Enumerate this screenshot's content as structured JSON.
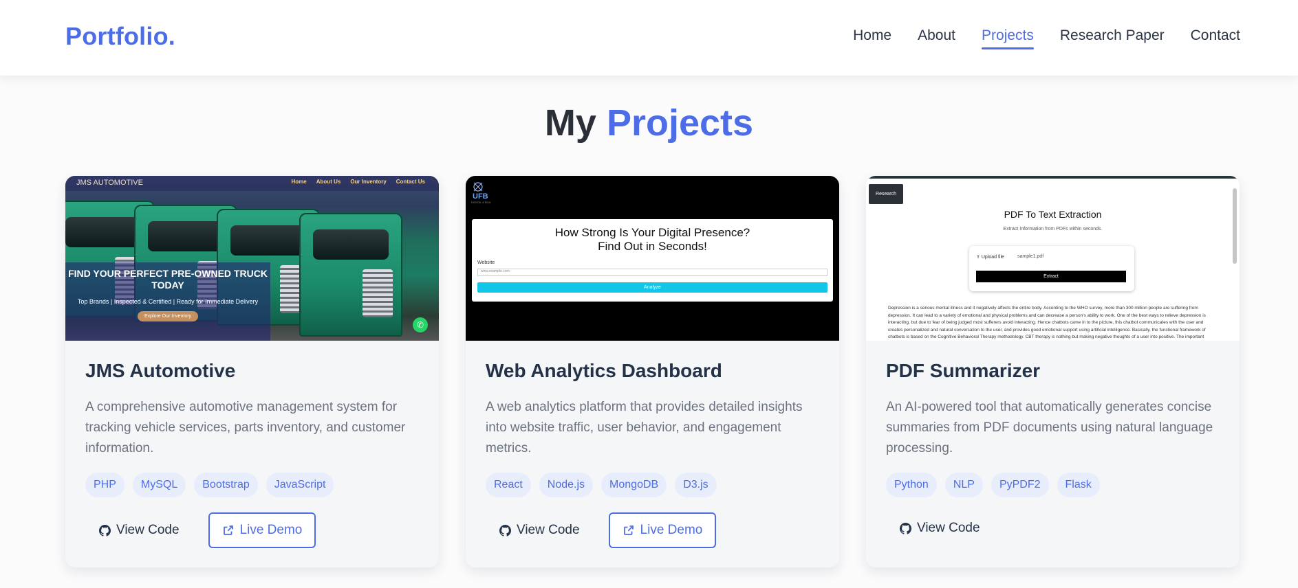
{
  "header": {
    "brand": "Portfolio.",
    "nav": [
      "Home",
      "About",
      "Projects",
      "Research Paper",
      "Contact"
    ],
    "active_nav": "Projects"
  },
  "section": {
    "title_part1": "My",
    "title_part2": "Projects"
  },
  "projects": [
    {
      "title": "JMS Automotive",
      "description": "A comprehensive automotive management system for tracking vehicle services, parts inventory, and customer information.",
      "tags": [
        "PHP",
        "MySQL",
        "Bootstrap",
        "JavaScript"
      ],
      "code_label": "View Code",
      "demo_label": "Live Demo",
      "screenshot": {
        "site_name": "JMS AUTOMOTIVE",
        "nav": [
          "Home",
          "About Us",
          "Our Inventory",
          "Contact Us"
        ],
        "headline": "FIND YOUR PERFECT PRE-OWNED TRUCK TODAY",
        "subline": "Top Brands | Inspected & Certified | Ready for Immediate Delivery",
        "cta": "Explore Our Inventory"
      }
    },
    {
      "title": "Web Analytics Dashboard",
      "description": "A web analytics platform that provides detailed insights into website traffic, user behavior, and engagement metrics.",
      "tags": [
        "React",
        "Node.js",
        "MongoDB",
        "D3.js"
      ],
      "code_label": "View Code",
      "demo_label": "Live Demo",
      "screenshot": {
        "logo": "UFB",
        "logo_sub": "DIGITAL & BOA",
        "question_line1": "How Strong Is Your Digital Presence?",
        "question_line2": "Find Out in Seconds!",
        "field_label": "Website",
        "field_value": "www.example.com",
        "button": "Analyze"
      }
    },
    {
      "title": "PDF Summarizer",
      "description": "An AI-powered tool that automatically generates concise summaries from PDF documents using natural language processing.",
      "tags": [
        "Python",
        "NLP",
        "PyPDF2",
        "Flask"
      ],
      "code_label": "View Code",
      "screenshot": {
        "corner_button": "Research",
        "title": "PDF To Text Extraction",
        "subtitle": "Extract Information from PDFs within seconds.",
        "upload_label": "Upload file",
        "file_name": "sample1.pdf",
        "extract_button": "Extract",
        "paragraph": "Depression is a serious mental illness and it negatively affects the entire body. According to the WHO survey, more than 300 million people are suffering from depression. It can lead to a variety of emotional and physical problems and can decrease a person's ability to work. One of the best ways to relieve depression is interacting, but due to fear of being judged most sufferers avoid interacting. Hence chatbots came in to the picture, this chatbot communicates with the user and creates personalized and natural conversation to the user, and provides good emotional support using artificial intelligence. Basically, the functional framework of chatbots is based on the Cognitive Behavioral Therapy methodology. CBT therapy is nothing but making negative thoughts of a user into positive. The important component in mental health chatbots is empathetic engagement. Depression is a serious mental health issue that affects"
      }
    }
  ],
  "colors": {
    "accent": "#4d6de6",
    "heading": "#243247",
    "muted": "#6b7280",
    "tag_bg": "#e8edfc"
  }
}
